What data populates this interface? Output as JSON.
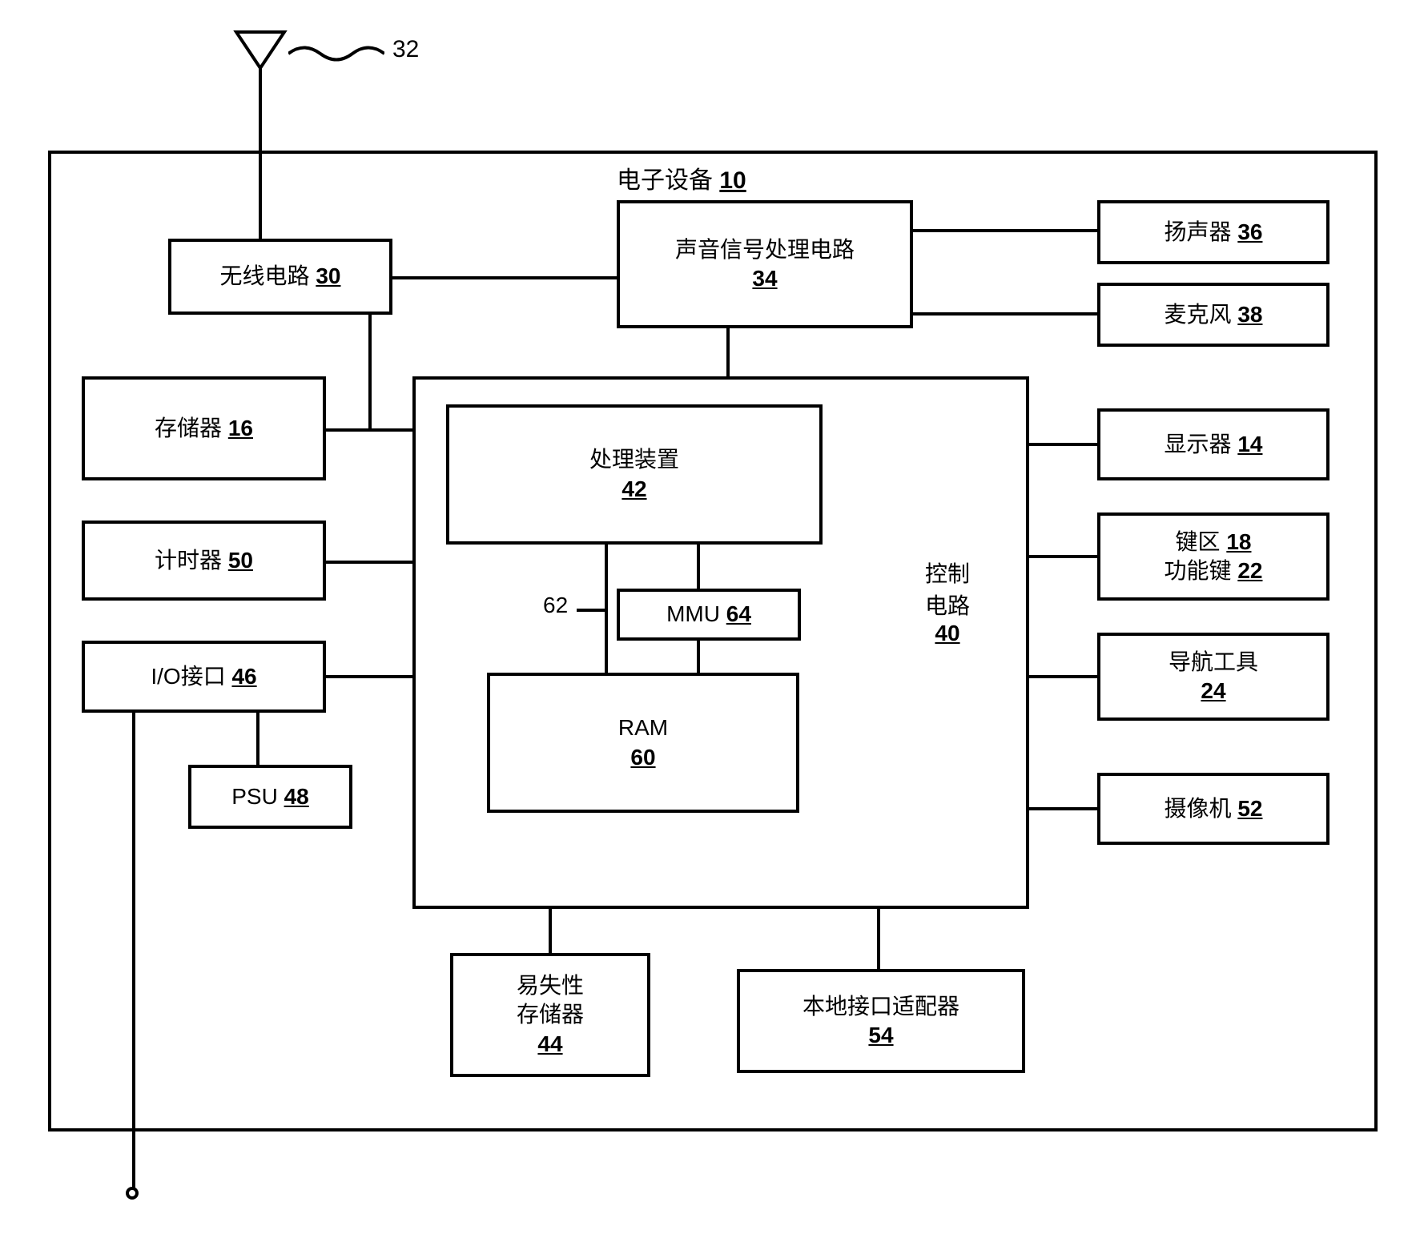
{
  "antenna_ref": "32",
  "device_title": "电子设备",
  "device_ref": "10",
  "radio": {
    "label": "无线电路",
    "ref": "30"
  },
  "audio": {
    "label": "声音信号处理电路",
    "ref": "34"
  },
  "speaker": {
    "label": "扬声器",
    "ref": "36"
  },
  "mic": {
    "label": "麦克风",
    "ref": "38"
  },
  "memory": {
    "label": "存储器",
    "ref": "16"
  },
  "timer": {
    "label": "计时器",
    "ref": "50"
  },
  "io": {
    "label": "I/O接口",
    "ref": "46"
  },
  "psu": {
    "label": "PSU",
    "ref": "48"
  },
  "display": {
    "label": "显示器",
    "ref": "14"
  },
  "keypad": {
    "label1": "键区",
    "ref1": "18",
    "label2": "功能键",
    "ref2": "22"
  },
  "nav": {
    "label": "导航工具",
    "ref": "24"
  },
  "camera": {
    "label": "摄像机",
    "ref": "52"
  },
  "control": {
    "label": "控制电路",
    "ref": "40"
  },
  "proc": {
    "label": "处理装置",
    "ref": "42"
  },
  "mmu": {
    "label": "MMU",
    "ref": "64"
  },
  "mmu_line_ref": "62",
  "ram": {
    "label": "RAM",
    "ref": "60"
  },
  "volatile_mem": {
    "label1": "易失性",
    "label2": "存储器",
    "ref": "44"
  },
  "local_adapter": {
    "label": "本地接口适配器",
    "ref": "54"
  }
}
